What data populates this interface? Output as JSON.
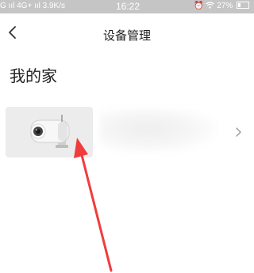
{
  "status_bar": {
    "left_text": "G ııl 4G+ ııl 3.9K/s",
    "time": "16:22",
    "battery_text": "27%",
    "battery_level": 0.27,
    "icons": [
      "alarm-icon",
      "wifi-icon",
      "battery-icon"
    ]
  },
  "header": {
    "back_icon": "chevron-left-icon",
    "title": "设备管理"
  },
  "home": {
    "title": "我的家"
  },
  "device": {
    "image": "security-camera",
    "name_visible": false,
    "chevron": "chevron-right-icon"
  },
  "annotation": {
    "type": "red-arrow",
    "color": "#f03c3c",
    "points_to": "device-thumbnail"
  },
  "colors": {
    "status_bar": "#c5c5c5",
    "thumb_bg": "#ececec",
    "text": "#222222"
  }
}
